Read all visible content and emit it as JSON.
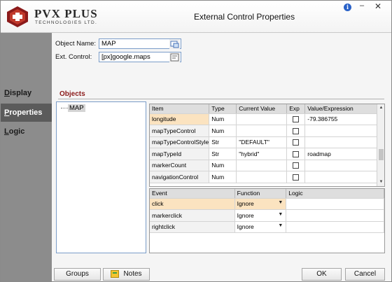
{
  "window": {
    "title": "External Control Properties",
    "brand": "PVX PLUS",
    "brand_sub": "TECHNOLOGIES LTD.",
    "info_glyph": "i",
    "minimize_glyph": "–",
    "close_glyph": "✕"
  },
  "sidebar": {
    "items": [
      {
        "label": "Display",
        "access": "D",
        "rest": "isplay",
        "active": false
      },
      {
        "label": "Properties",
        "access": "P",
        "rest": "roperties",
        "active": true
      },
      {
        "label": "Logic",
        "access": "L",
        "rest": "ogic",
        "active": false
      }
    ]
  },
  "form": {
    "object_name_label": "Object Name:",
    "object_name_value": "MAP",
    "ext_control_label": "Ext. Control:",
    "ext_control_value": "[px]google.maps"
  },
  "objects": {
    "title": "Objects",
    "tree_item": "MAP"
  },
  "properties": {
    "columns": [
      "Item",
      "Type",
      "Current Value",
      "Exp",
      "Value/Expression"
    ],
    "rows": [
      {
        "item": "longitude",
        "type": "Num",
        "current": "",
        "exp": false,
        "value": "-79.386755",
        "highlight": true
      },
      {
        "item": "mapTypeControl",
        "type": "Num",
        "current": "",
        "exp": false,
        "value": ""
      },
      {
        "item": "mapTypeControlStyle",
        "type": "Str",
        "current": "\"DEFAULT\"",
        "exp": false,
        "value": ""
      },
      {
        "item": "mapTypeId",
        "type": "Str",
        "current": "\"hybrid\"",
        "exp": false,
        "value": "roadmap"
      },
      {
        "item": "markerCount",
        "type": "Num",
        "current": "",
        "exp": false,
        "value": ""
      },
      {
        "item": "navigationControl",
        "type": "Num",
        "current": "",
        "exp": false,
        "value": ""
      }
    ]
  },
  "events": {
    "columns": [
      "Event",
      "Function",
      "Logic"
    ],
    "rows": [
      {
        "event": "click",
        "function": "Ignore",
        "logic": "",
        "highlight": true
      },
      {
        "event": "markerclick",
        "function": "Ignore",
        "logic": ""
      },
      {
        "event": "rightclick",
        "function": "Ignore",
        "logic": ""
      }
    ]
  },
  "buttons": {
    "groups": "Groups",
    "notes": "Notes",
    "ok": "OK",
    "cancel": "Cancel"
  },
  "colors": {
    "sidebar_bg": "#8c8c8c",
    "sidebar_active": "#5b5b5b",
    "objects_title": "#8b1a1a",
    "row_highlight": "#fbe3c0",
    "field_border": "#7a9cc8"
  }
}
